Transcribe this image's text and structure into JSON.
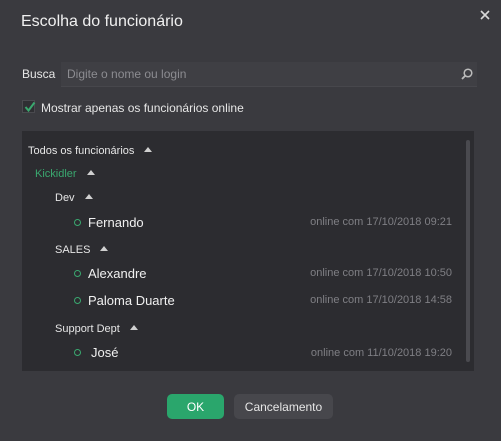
{
  "dialog": {
    "title": "Escolha do funcionário",
    "close_icon": "close-icon"
  },
  "search": {
    "label": "Busca",
    "placeholder": "Digite o nome ou login",
    "value": "",
    "icon": "search-icon"
  },
  "filter": {
    "online_only_label": "Mostrar apenas os funcionários online",
    "online_only_checked": true
  },
  "tree": {
    "root": {
      "label": "Todos os funcionários",
      "expanded": true
    },
    "company": {
      "label": "Kickidler",
      "color": "#3aa86f",
      "expanded": true
    },
    "groups": [
      {
        "label": "Dev",
        "expanded": true,
        "employees": [
          {
            "name": "Fernando",
            "status": "online com 17/10/2018 09:21"
          }
        ]
      },
      {
        "label": "SALES",
        "expanded": true,
        "employees": [
          {
            "name": "Alexandre",
            "status": "online com 17/10/2018 10:50"
          },
          {
            "name": "Paloma Duarte",
            "status": "online com 17/10/2018 14:58"
          }
        ]
      },
      {
        "label": "Support Dept",
        "expanded": true,
        "employees": [
          {
            "name": "José",
            "status": "online com 11/10/2018 19:20"
          }
        ]
      }
    ]
  },
  "buttons": {
    "ok_label": "OK",
    "cancel_label": "Cancelamento"
  },
  "colors": {
    "background": "#3a3a3f",
    "list_background": "#2c2c30",
    "accent_green": "#2aa66c",
    "online_dot": "#3aa86f",
    "status_text": "#7f7f84"
  }
}
